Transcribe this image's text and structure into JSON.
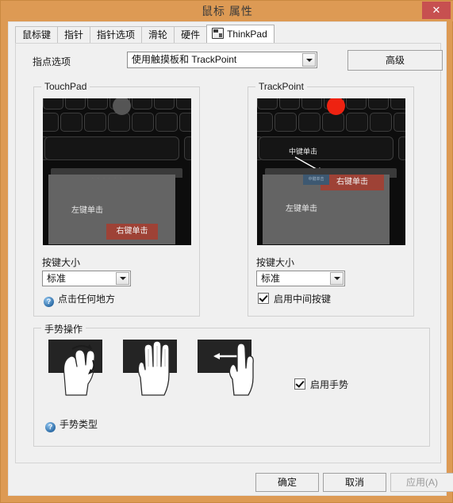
{
  "window": {
    "title": "鼠标 属性",
    "close_label": "✕",
    "frame_color": "#dd9a54",
    "close_color": "#c75050"
  },
  "tabs": [
    {
      "label": "鼠标键",
      "selected": false
    },
    {
      "label": "指针",
      "selected": false
    },
    {
      "label": "指针选项",
      "selected": false
    },
    {
      "label": "滑轮",
      "selected": false
    },
    {
      "label": "硬件",
      "selected": false
    },
    {
      "label": "ThinkPad",
      "selected": true,
      "icon": "thinkpad-icon"
    }
  ],
  "pointing": {
    "label": "指点选项",
    "value": "使用触摸板和 TrackPoint",
    "advanced_button": "高级"
  },
  "touchpad": {
    "group_title": "TouchPad",
    "left_click": "左键单击",
    "right_click": "右键单击",
    "size_label": "按键大小",
    "size_value": "标准",
    "help_link": "点击任何地方",
    "help_icon": "question-help-icon"
  },
  "trackpoint": {
    "group_title": "TrackPoint",
    "middle_click_callout": "中键单击",
    "middle_click_button": "中键单击",
    "left_click": "左键单击",
    "right_click": "右键单击",
    "size_label": "按键大小",
    "size_value": "标准",
    "checkbox_label": "启用中间按键",
    "checkbox_checked": true
  },
  "gesture": {
    "group_title": "手势操作",
    "items": [
      {
        "name": "rotate-pinch-gesture"
      },
      {
        "name": "three-finger-gesture"
      },
      {
        "name": "swipe-left-gesture"
      }
    ],
    "enable_label": "启用手势",
    "enable_checked": true,
    "help_link": "手势类型",
    "help_icon": "question-help-icon"
  },
  "footer": {
    "ok": "确定",
    "cancel": "取消",
    "apply": "应用(A)",
    "apply_disabled": true
  },
  "colors": {
    "right_click_red": "#9e4236",
    "middle_click_blue": "#3d5871",
    "trackpoint_red": "#ee2211",
    "surface_gray": "#646464"
  }
}
